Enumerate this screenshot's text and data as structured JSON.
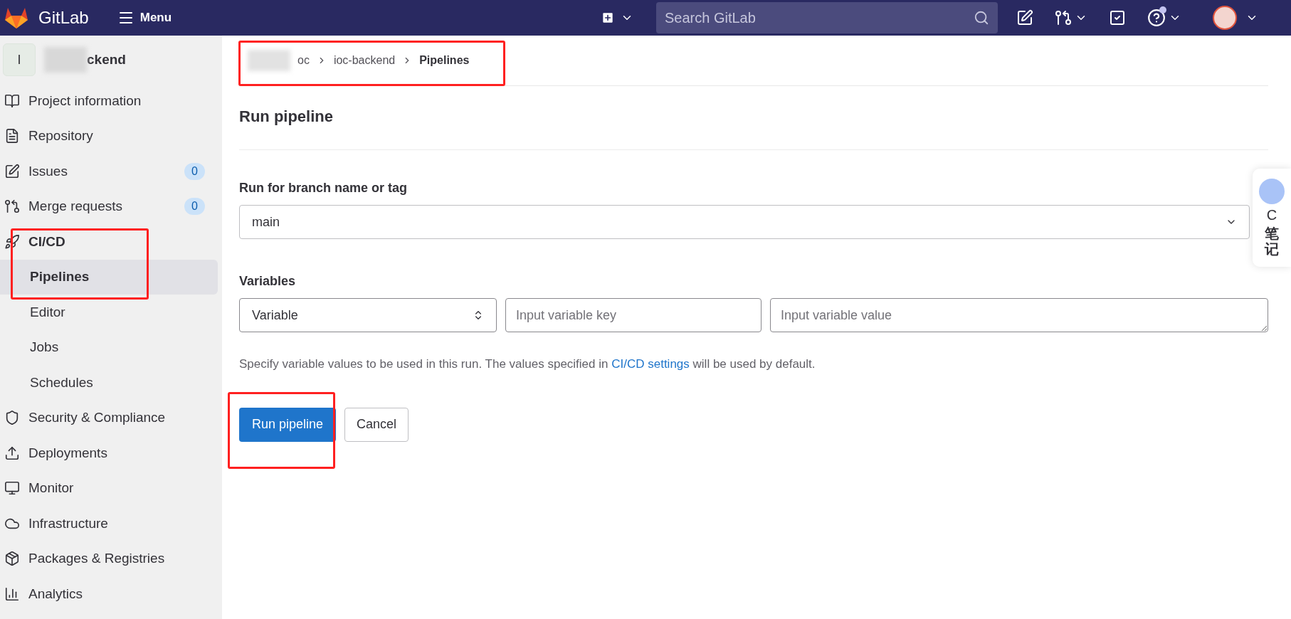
{
  "header": {
    "brand": "GitLab",
    "menu": "Menu",
    "search": {
      "placeholder": "Search GitLab"
    },
    "help_notification": true
  },
  "sidebar": {
    "project": {
      "avatar": "I",
      "name": "ckend"
    },
    "items": [
      {
        "label": "Project information",
        "selected": false
      },
      {
        "label": "Repository",
        "selected": false
      },
      {
        "label": "Issues",
        "badge": "0",
        "selected": false
      },
      {
        "label": "Merge requests",
        "badge": "0",
        "selected": false
      },
      {
        "label": "CI/CD",
        "selected": true,
        "expanded": true,
        "children": [
          {
            "label": "Pipelines",
            "selected": true
          },
          {
            "label": "Editor",
            "selected": false
          },
          {
            "label": "Jobs",
            "selected": false
          },
          {
            "label": "Schedules",
            "selected": false
          }
        ]
      },
      {
        "label": "Security & Compliance",
        "selected": false
      },
      {
        "label": "Deployments",
        "selected": false
      },
      {
        "label": "Monitor",
        "selected": false
      },
      {
        "label": "Infrastructure",
        "selected": false
      },
      {
        "label": "Packages & Registries",
        "selected": false
      },
      {
        "label": "Analytics",
        "selected": false
      }
    ]
  },
  "breadcrumb": [
    "oc",
    "ioc-backend",
    "Pipelines"
  ],
  "page": {
    "title": "Run pipeline",
    "branch_label": "Run for branch name or tag",
    "branch_value": "main",
    "variables_label": "Variables",
    "variable_type": "Variable",
    "key_placeholder": "Input variable key",
    "value_placeholder": "Input variable value",
    "help_before": "Specify variable values to be used in this run. The values specified in",
    "help_link": "CI/CD settings",
    "help_after": "will be used by default.",
    "buttons": [
      {
        "label": "Run pipeline",
        "kind": "primary"
      },
      {
        "label": "Cancel",
        "kind": "secondary"
      }
    ]
  },
  "note_widget": {
    "letter": "C",
    "label": "笔记"
  }
}
